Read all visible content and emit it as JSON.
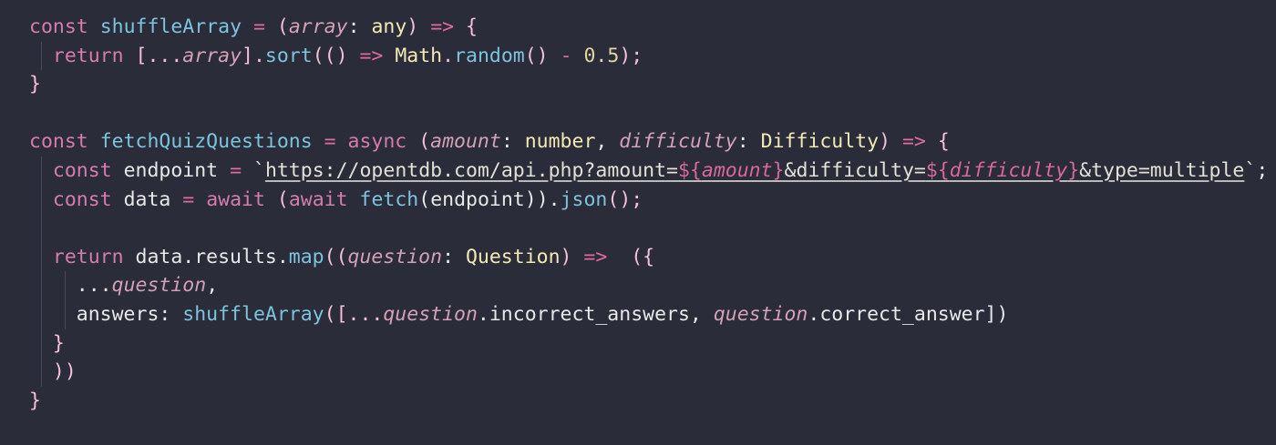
{
  "editor": {
    "theme": "dark",
    "background": "#2a2c3a"
  },
  "code": {
    "l1": {
      "t1": "const",
      "t2": " ",
      "t3": "shuffleArray",
      "t4": " = ",
      "t5": "(",
      "t6": "array",
      "t7": ": ",
      "t8": "any",
      "t9": ")",
      "t10": " => ",
      "t11": "{"
    },
    "l2": {
      "t1": "return",
      "t2": " [...",
      "t3": "array",
      "t4": "].",
      "t5": "sort",
      "t6": "(() ",
      "t7": "=>",
      "t8": " ",
      "t9": "Math",
      "t10": ".",
      "t11": "random",
      "t12": "() ",
      "t13": "-",
      "t14": " ",
      "t15": "0.5",
      "t16": ");"
    },
    "l3": {
      "t1": "}"
    },
    "l5": {
      "t1": "const",
      "t2": " ",
      "t3": "fetchQuizQuestions",
      "t4": " = ",
      "t5": "async",
      "t6": " (",
      "t7": "amount",
      "t8": ": ",
      "t9": "number",
      "t10": ", ",
      "t11": "difficulty",
      "t12": ": ",
      "t13": "Difficulty",
      "t14": ")",
      "t15": " => ",
      "t16": "{"
    },
    "l6": {
      "t1": "const",
      "t2": " ",
      "t3": "endpoint",
      "t4": " = ",
      "t5": "`",
      "t6": "https://opentdb.com/api.php?amount=",
      "t7": "${",
      "t8": "amount",
      "t9": "}",
      "t10": "&difficulty=",
      "t11": "${",
      "t12": "difficulty",
      "t13": "}",
      "t14": "&type=multiple",
      "t15": "`",
      "t16": ";"
    },
    "l7": {
      "t1": "const",
      "t2": " ",
      "t3": "data",
      "t4": " = ",
      "t5": "await",
      "t6": " (",
      "t7": "await",
      "t8": " ",
      "t9": "fetch",
      "t10": "(endpoint)).",
      "t11": "json",
      "t12": "();"
    },
    "l9": {
      "t1": "return",
      "t2": " data.results.",
      "t3": "map",
      "t4": "((",
      "t5": "question",
      "t6": ": ",
      "t7": "Question",
      "t8": ") ",
      "t9": "=>",
      "t10": "  ({"
    },
    "l10": {
      "t1": "...",
      "t2": "question",
      "t3": ","
    },
    "l11": {
      "t1": "answers",
      "t2": ": ",
      "t3": "shuffleArray",
      "t4": "([...",
      "t5": "question",
      "t6": ".incorrect_answers, ",
      "t7": "question",
      "t8": ".correct_answer])"
    },
    "l12": {
      "t1": "}"
    },
    "l13": {
      "t1": "))"
    },
    "l14": {
      "t1": "}"
    }
  }
}
